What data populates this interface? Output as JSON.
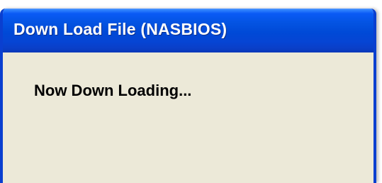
{
  "window": {
    "title": "Down Load File (NASBIOS)"
  },
  "content": {
    "status": "Now Down Loading..."
  },
  "colors": {
    "titlebar_blue": "#0454E3",
    "client_background": "#ECE9D8",
    "frame_blue": "#0A3FD0"
  }
}
